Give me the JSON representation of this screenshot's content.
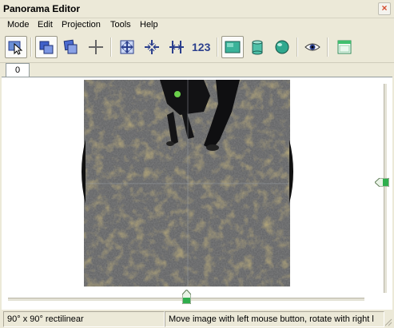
{
  "window": {
    "title": "Panorama Editor",
    "close_glyph": "×"
  },
  "menu": [
    "Mode",
    "Edit",
    "Projection",
    "Tools",
    "Help"
  ],
  "toolbar": {
    "buttons": [
      {
        "name": "select-mode-icon",
        "active": true
      },
      {
        "name": "move-images-icon",
        "active": true
      },
      {
        "name": "images-stack-icon",
        "active": false
      },
      {
        "name": "crosshair-icon",
        "active": false
      },
      {
        "name": "fit-expand-icon",
        "active": false
      },
      {
        "name": "center-icon",
        "active": false
      },
      {
        "name": "straighten-icon",
        "active": false
      },
      {
        "name": "rectilinear-projection-icon",
        "active": true
      },
      {
        "name": "cylindrical-projection-icon",
        "active": false
      },
      {
        "name": "spherical-projection-icon",
        "active": false
      },
      {
        "name": "preview-eye-icon",
        "active": false
      },
      {
        "name": "window-panel-icon",
        "active": false
      }
    ],
    "number_label": "123"
  },
  "tabs": [
    "0"
  ],
  "sliders": {
    "vertical_position": 0.5,
    "horizontal_position": 0.5
  },
  "status": {
    "projection": "90° x 90° rectilinear",
    "hint": "Move image with left mouse button, rotate with right l"
  },
  "colors": {
    "accent_blue": "#2b3f8d",
    "green_thumb": "#2fae4d"
  }
}
